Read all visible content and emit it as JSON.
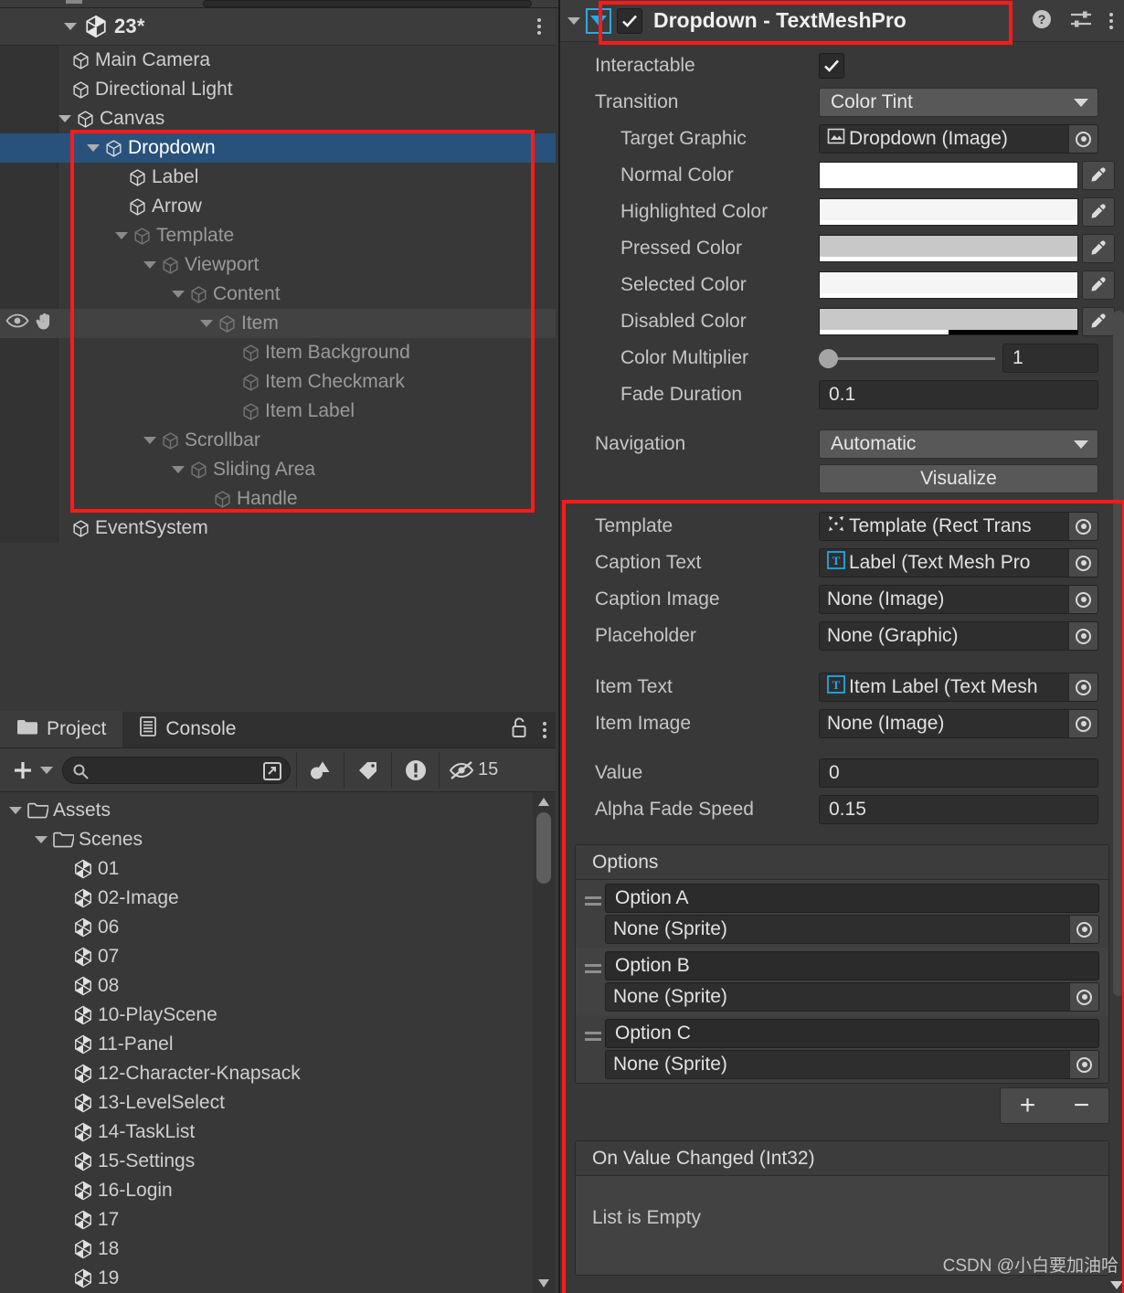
{
  "hierarchy": {
    "scene_name": "23*",
    "items": [
      {
        "label": "Main Camera",
        "depth": 1,
        "foldout": "none",
        "state": "normal"
      },
      {
        "label": "Directional Light",
        "depth": 1,
        "foldout": "none",
        "state": "normal"
      },
      {
        "label": "Canvas",
        "depth": 1,
        "foldout": "open",
        "state": "normal"
      },
      {
        "label": "Dropdown",
        "depth": 2,
        "foldout": "open",
        "state": "selected"
      },
      {
        "label": "Label",
        "depth": 3,
        "foldout": "none",
        "state": "normal"
      },
      {
        "label": "Arrow",
        "depth": 3,
        "foldout": "none",
        "state": "normal"
      },
      {
        "label": "Template",
        "depth": 3,
        "foldout": "open",
        "state": "dim"
      },
      {
        "label": "Viewport",
        "depth": 4,
        "foldout": "open",
        "state": "dim"
      },
      {
        "label": "Content",
        "depth": 5,
        "foldout": "open",
        "state": "dim"
      },
      {
        "label": "Item",
        "depth": 6,
        "foldout": "open",
        "state": "dim-hover"
      },
      {
        "label": "Item Background",
        "depth": 7,
        "foldout": "none",
        "state": "dim"
      },
      {
        "label": "Item Checkmark",
        "depth": 7,
        "foldout": "none",
        "state": "dim"
      },
      {
        "label": "Item Label",
        "depth": 7,
        "foldout": "none",
        "state": "dim"
      },
      {
        "label": "Scrollbar",
        "depth": 4,
        "foldout": "open",
        "state": "dim"
      },
      {
        "label": "Sliding Area",
        "depth": 5,
        "foldout": "open",
        "state": "dim"
      },
      {
        "label": "Handle",
        "depth": 6,
        "foldout": "none",
        "state": "dim"
      },
      {
        "label": "EventSystem",
        "depth": 1,
        "foldout": "none",
        "state": "normal"
      }
    ]
  },
  "project": {
    "tabs": [
      {
        "label": "Project",
        "active": true,
        "icon": "folder-icon"
      },
      {
        "label": "Console",
        "active": false,
        "icon": "console-icon"
      }
    ],
    "search_value": "",
    "search_placeholder": "",
    "hidden_count": "15",
    "tree": [
      {
        "label": "Assets",
        "depth": 0,
        "type": "folder",
        "foldout": "open"
      },
      {
        "label": "Scenes",
        "depth": 1,
        "type": "folder",
        "foldout": "open"
      },
      {
        "label": "01",
        "depth": 2,
        "type": "scene",
        "foldout": "none"
      },
      {
        "label": "02-Image",
        "depth": 2,
        "type": "scene",
        "foldout": "none"
      },
      {
        "label": "06",
        "depth": 2,
        "type": "scene",
        "foldout": "none"
      },
      {
        "label": "07",
        "depth": 2,
        "type": "scene",
        "foldout": "none"
      },
      {
        "label": "08",
        "depth": 2,
        "type": "scene",
        "foldout": "none"
      },
      {
        "label": "10-PlayScene",
        "depth": 2,
        "type": "scene",
        "foldout": "none"
      },
      {
        "label": "11-Panel",
        "depth": 2,
        "type": "scene",
        "foldout": "none"
      },
      {
        "label": "12-Character-Knapsack",
        "depth": 2,
        "type": "scene",
        "foldout": "none"
      },
      {
        "label": "13-LevelSelect",
        "depth": 2,
        "type": "scene",
        "foldout": "none"
      },
      {
        "label": "14-TaskList",
        "depth": 2,
        "type": "scene",
        "foldout": "none"
      },
      {
        "label": "15-Settings",
        "depth": 2,
        "type": "scene",
        "foldout": "none"
      },
      {
        "label": "16-Login",
        "depth": 2,
        "type": "scene",
        "foldout": "none"
      },
      {
        "label": "17",
        "depth": 2,
        "type": "scene",
        "foldout": "none"
      },
      {
        "label": "18",
        "depth": 2,
        "type": "scene",
        "foldout": "none"
      },
      {
        "label": "19",
        "depth": 2,
        "type": "scene",
        "foldout": "none"
      }
    ]
  },
  "inspector": {
    "component_title": "Dropdown - TextMeshPro",
    "component_enabled": true,
    "interactable": {
      "label": "Interactable",
      "checked": true
    },
    "transition": {
      "label": "Transition",
      "value": "Color Tint"
    },
    "target_graphic": {
      "label": "Target Graphic",
      "value": "Dropdown (Image)"
    },
    "colors": [
      {
        "label": "Normal Color",
        "hex": "#ffffff",
        "alpha_pct": 100
      },
      {
        "label": "Highlighted Color",
        "hex": "#f5f5f5",
        "alpha_pct": 100
      },
      {
        "label": "Pressed Color",
        "hex": "#c8c8c8",
        "alpha_pct": 100
      },
      {
        "label": "Selected Color",
        "hex": "#f5f5f5",
        "alpha_pct": 100
      },
      {
        "label": "Disabled Color",
        "hex": "#c8c8c8",
        "alpha_pct": 50
      }
    ],
    "color_multiplier": {
      "label": "Color Multiplier",
      "value": "1",
      "slider_pct": 0
    },
    "fade_duration": {
      "label": "Fade Duration",
      "value": "0.1"
    },
    "navigation": {
      "label": "Navigation",
      "value": "Automatic"
    },
    "visualize_button": "Visualize",
    "refs": [
      {
        "label": "Template",
        "value": "Template (Rect Trans",
        "icon": "rect-transform-icon"
      },
      {
        "label": "Caption Text",
        "value": "Label (Text Mesh Pro",
        "icon": "textmeshpro-icon"
      },
      {
        "label": "Caption Image",
        "value": "None (Image)",
        "icon": "none"
      },
      {
        "label": "Placeholder",
        "value": "None (Graphic)",
        "icon": "none"
      }
    ],
    "item_refs": [
      {
        "label": "Item Text",
        "value": "Item Label (Text Mesh",
        "icon": "textmeshpro-icon"
      },
      {
        "label": "Item Image",
        "value": "None (Image)",
        "icon": "none"
      }
    ],
    "value_field": {
      "label": "Value",
      "value": "0"
    },
    "alpha_fade_speed": {
      "label": "Alpha Fade Speed",
      "value": "0.15"
    },
    "options": {
      "title": "Options",
      "items": [
        {
          "text": "Option A",
          "sprite": "None (Sprite)"
        },
        {
          "text": "Option B",
          "sprite": "None (Sprite)"
        },
        {
          "text": "Option C",
          "sprite": "None (Sprite)"
        }
      ],
      "add_label": "+",
      "remove_label": "−"
    },
    "on_value_changed": {
      "title": "On Value Changed (Int32)",
      "empty_text": "List is Empty"
    }
  },
  "watermark": "CSDN @小白要加油哈",
  "accents": {
    "annotation_red": "#ff1a1a",
    "selection_blue": "#28527c",
    "foldout_cyan": "#2fa9e0"
  }
}
